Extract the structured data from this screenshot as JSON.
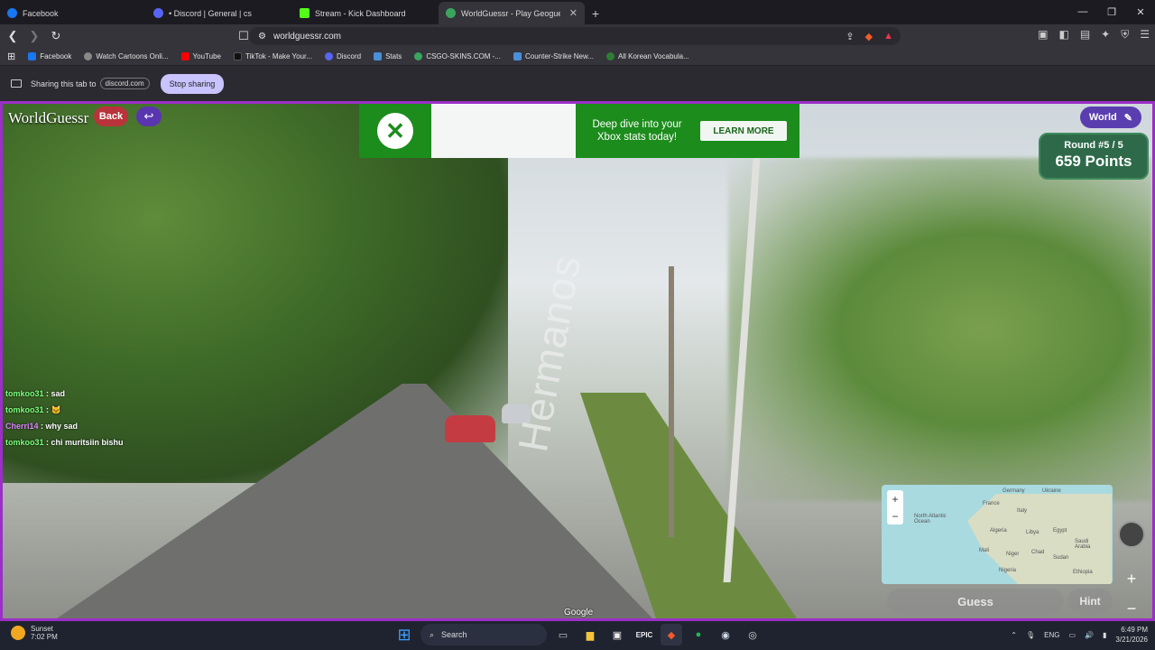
{
  "browser": {
    "tabs": [
      {
        "label": "Facebook",
        "color": "#1877f2"
      },
      {
        "label": "• Discord | General | cs",
        "color": "#5865f2"
      },
      {
        "label": "Stream - Kick Dashboard",
        "color": "#53fc18"
      },
      {
        "label": "WorldGuessr - Play Geoguessr",
        "color": "#3aa55d"
      }
    ],
    "url": "worldguessr.com",
    "bookmarks": [
      {
        "label": "Facebook",
        "color": "#1877f2"
      },
      {
        "label": "Watch Cartoons Onli...",
        "color": "#888"
      },
      {
        "label": "YouTube",
        "color": "#ff0000"
      },
      {
        "label": "TikTok - Make Your...",
        "color": "#111"
      },
      {
        "label": "Discord",
        "color": "#5865f2"
      },
      {
        "label": "Stats",
        "color": "#4a90d9"
      },
      {
        "label": "CSGO-SKINS.COM -...",
        "color": "#3aa55d"
      },
      {
        "label": "Counter-Strike New...",
        "color": "#4a90d9"
      },
      {
        "label": "All Korean Vocabula...",
        "color": "#2e7d32"
      }
    ],
    "share": {
      "text": "Sharing this tab to",
      "target": "discord.com",
      "stop": "Stop sharing"
    }
  },
  "game": {
    "logo": "WorldGuessr",
    "back": "Back",
    "map_name": "World",
    "round": "Round #5 / 5",
    "points": "659 Points",
    "ad": {
      "text": "Deep dive into your Xbox stats today!",
      "cta": "LEARN MORE"
    },
    "street_label": "Hermanos",
    "google": "Google",
    "guess": "Guess",
    "hint": "Hint",
    "minimap": {
      "labels": [
        "Germany",
        "Ukraine",
        "France",
        "Italy",
        "North Atlantic Ocean",
        "Algeria",
        "Libya",
        "Egypt",
        "Saudi Arabia",
        "Mali",
        "Niger",
        "Chad",
        "Sudan",
        "Nigeria",
        "Ethiopia"
      ]
    }
  },
  "chat": [
    {
      "user": "tomkoo31",
      "msg": "sad"
    },
    {
      "user": "tomkoo31",
      "msg": "🐱"
    },
    {
      "user": "Cherri14",
      "msg": "why sad"
    },
    {
      "user": "tomkoo31",
      "msg": "chi muritsiin bishu"
    }
  ],
  "taskbar": {
    "weather_title": "Sunset",
    "weather_time": "7:02 PM",
    "search": "Search",
    "lang": "ENG",
    "time": "6:49 PM",
    "date": "3/21/2026"
  }
}
